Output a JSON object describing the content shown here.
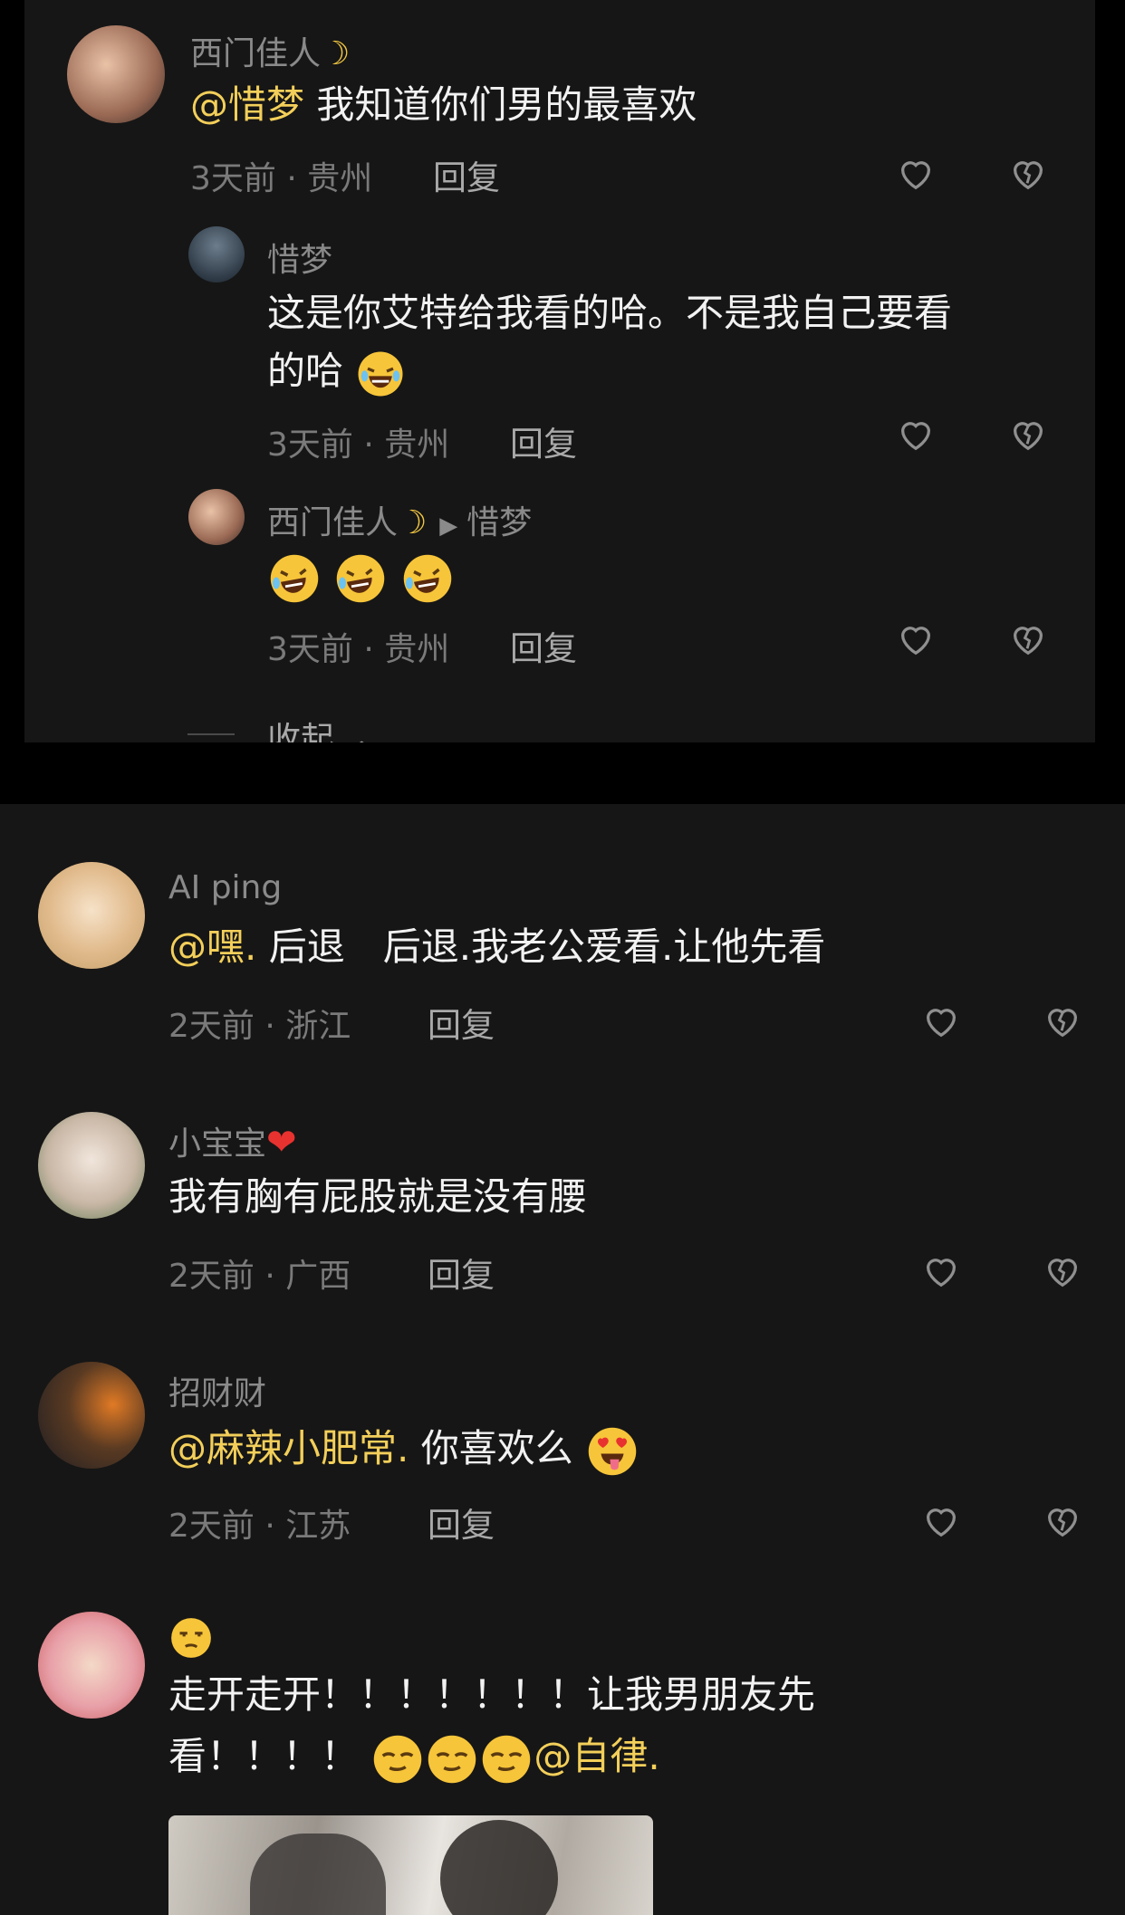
{
  "top_thread": {
    "main": {
      "username": "西门佳人",
      "mention": "@惜梦",
      "text": " 我知道你们男的最喜欢",
      "time_location": "3天前 · 贵州",
      "reply_label": "回复"
    },
    "replies": [
      {
        "username": "惜梦",
        "text_line1": "这是你艾特给我看的哈。不是我自己要看",
        "text_line2": "的哈",
        "time_location": "3天前 · 贵州",
        "reply_label": "回复"
      },
      {
        "username": "西门佳人",
        "reply_to": "惜梦",
        "time_location": "3天前 · 贵州",
        "reply_label": "回复"
      }
    ],
    "collapse_label": "收起"
  },
  "comments": [
    {
      "username": "AI ping",
      "mention": "@嘿.",
      "text": " 后退　后退.我老公爱看.让他先看",
      "time_location": "2天前 · 浙江",
      "reply_label": "回复"
    },
    {
      "username": "小宝宝",
      "text": "我有胸有屁股就是没有腰",
      "time_location": "2天前 · 广西",
      "reply_label": "回复"
    },
    {
      "username": "招财财",
      "mention": "@麻辣小肥常.",
      "text": " 你喜欢么",
      "time_location": "2天前 · 江苏",
      "reply_label": "回复"
    },
    {
      "username": "",
      "text_line1": "走开走开！！！！！！！让我男朋友先",
      "text_line2": "看！！！！",
      "mention": "@自律."
    }
  ],
  "icons": {
    "like": "heart-outline-icon",
    "dislike": "broken-heart-outline-icon"
  },
  "colors": {
    "background": "#000000",
    "panel": "#161616",
    "mention": "#f3cf5a",
    "meta": "#7a7a7a"
  }
}
